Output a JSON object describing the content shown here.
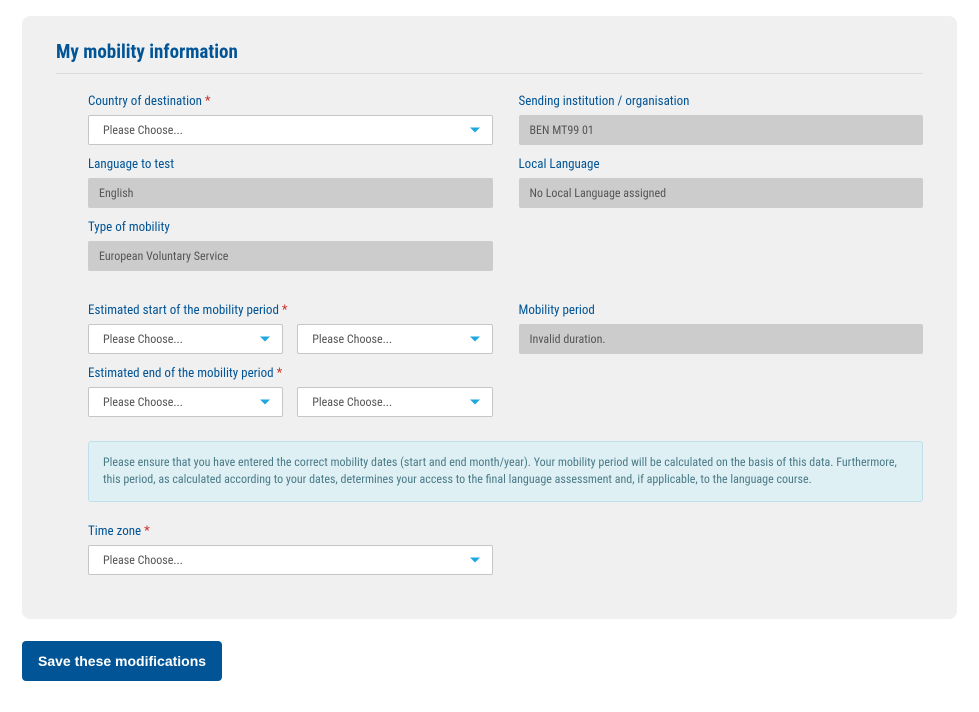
{
  "panel": {
    "title": "My mobility information"
  },
  "required_mark": "*",
  "fields": {
    "country_label": "Country of destination",
    "country_value": "Please Choose...",
    "sending_label": "Sending institution / organisation",
    "sending_value": "BEN MT99 01",
    "lang_test_label": "Language to test",
    "lang_test_value": "English",
    "local_lang_label": "Local Language",
    "local_lang_value": "No Local Language assigned",
    "mobility_type_label": "Type of mobility",
    "mobility_type_value": "European Voluntary Service",
    "est_start_label": "Estimated start of the mobility period",
    "est_start_month": "Please Choose...",
    "est_start_year": "Please Choose...",
    "mobility_period_label": "Mobility period",
    "mobility_period_value": "Invalid duration.",
    "est_end_label": "Estimated end of the mobility period",
    "est_end_month": "Please Choose...",
    "est_end_year": "Please Choose...",
    "timezone_label": "Time zone",
    "timezone_value": "Please Choose..."
  },
  "info_text": "Please ensure that you have entered the correct mobility dates (start and end month/year). Your mobility period will be calculated on the basis of this data. Furthermore, this period, as calculated according to your dates, determines your access to the final language assessment and, if applicable, to the language course.",
  "buttons": {
    "save": "Save these modifications"
  }
}
